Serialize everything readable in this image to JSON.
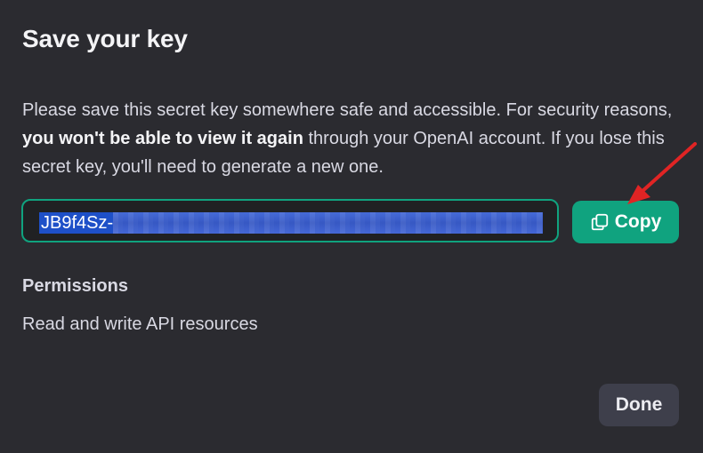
{
  "dialog": {
    "title": "Save your key",
    "description": {
      "part1": "Please save this secret key somewhere safe and accessible. For security reasons, ",
      "bold": "you won't be able to view it again",
      "part2": " through your OpenAI account. If you lose this secret key, you'll need to generate a new one."
    },
    "key": {
      "visible_prefix": "JB9f4Sz-",
      "obscured": true
    },
    "copy_button": {
      "label": "Copy",
      "icon": "copy-icon"
    },
    "permissions": {
      "heading": "Permissions",
      "value": "Read and write API resources"
    },
    "done_button": {
      "label": "Done"
    }
  },
  "colors": {
    "background": "#2b2b30",
    "accent": "#10a37f",
    "selection": "#1e50c8",
    "annotation_arrow": "#e02424",
    "secondary_button": "#3e3f4b"
  },
  "annotation": {
    "icon": "red-arrow-pointing-to-copy"
  }
}
